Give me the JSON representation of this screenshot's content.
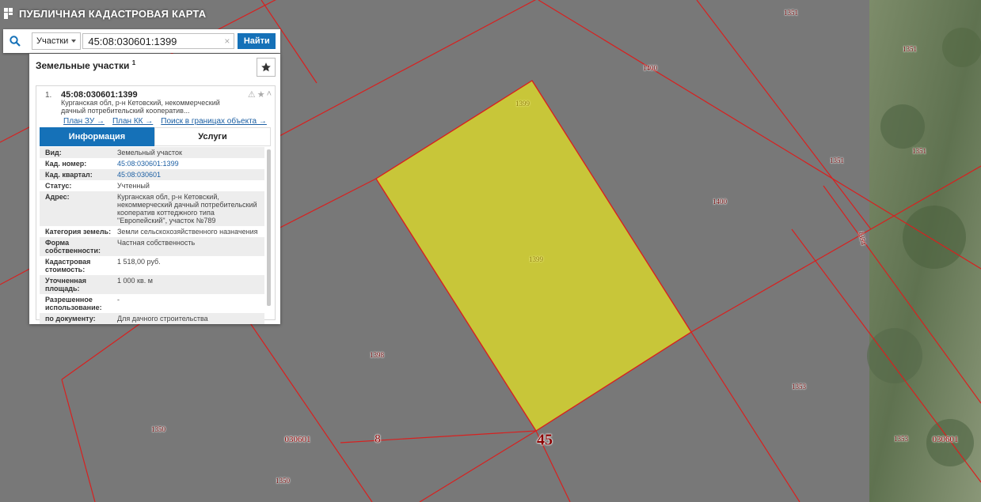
{
  "app": {
    "title": "ПУБЛИЧНАЯ КАДАСТРОВАЯ КАРТА"
  },
  "search": {
    "type_label": "Участки",
    "query": "45:08:030601:1399",
    "clear": "×",
    "button": "Найти"
  },
  "panel": {
    "title": "Земельные участки",
    "count": "1",
    "card": {
      "index": "1.",
      "cad_number": "45:08:030601:1399",
      "address_short": "Курганская обл, р-н Кетовский, некоммерческий дачный потребительский кооператив...",
      "links": [
        "План ЗУ →",
        "План КК →",
        "Поиск в границах объекта →"
      ],
      "tabs": {
        "info": "Информация",
        "services": "Услуги"
      },
      "rows": [
        {
          "k": "Вид:",
          "v": "Земельный участок"
        },
        {
          "k": "Кад. номер:",
          "v": "45:08:030601:1399"
        },
        {
          "k": "Кад. квартал:",
          "v": "45:08:030601"
        },
        {
          "k": "Статус:",
          "v": "Учтенный"
        },
        {
          "k": "Адрес:",
          "v": "Курганская обл, р-н Кетовский, некоммерческий дачный потребительский кооператив коттеджного типа \"Европейский\", участок №789"
        },
        {
          "k": "Категория земель:",
          "v": "Земли сельскохозяйственного назначения"
        },
        {
          "k": "Форма собственности:",
          "v": "Частная собственность"
        },
        {
          "k": "Кадастровая стоимость:",
          "v": "1 518,00 руб."
        },
        {
          "k": "Уточненная площадь:",
          "v": "1 000 кв. м"
        },
        {
          "k": "Разрешенное использование:",
          "v": "-"
        },
        {
          "k": "по документу:",
          "v": "Для дачного строительства"
        }
      ]
    }
  },
  "map": {
    "labels": {
      "p1351a": "1351",
      "p1351b": "1351",
      "p1351c": "1351",
      "p1351d": "1351",
      "p1400a": "1400",
      "p1400b": "1400",
      "p1399a": "1399",
      "p1399b": "1399",
      "p1354": "1354",
      "p1398": "1398",
      "p1350a": "1350",
      "p1350b": "1350",
      "p1353a": "1353",
      "p1353b": "1353",
      "q1": "030601",
      "q2": "030601",
      "d8": "8",
      "r45": "45"
    },
    "colors": {
      "boundary": "#d8201f",
      "selected_fill": "#d6d42e"
    }
  }
}
